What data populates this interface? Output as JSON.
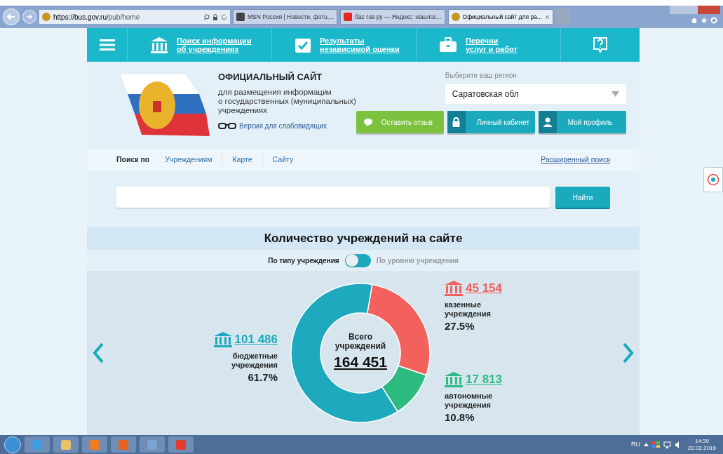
{
  "browser": {
    "address_host": "https://bus.gov.ru",
    "address_path": "/pub/home",
    "tabs": [
      {
        "title": "MSN Россия | Новости, фото,...",
        "kind": "msn",
        "selected": false
      },
      {
        "title": "бас гов ру — Яндекс: нашлос...",
        "kind": "yandex",
        "selected": false
      },
      {
        "title": "Официальный сайт для ра...",
        "kind": "site",
        "selected": true
      }
    ]
  },
  "nav": {
    "links": [
      {
        "kind": "building",
        "lines": [
          "Поиск информации",
          "об учреждениях"
        ]
      },
      {
        "kind": "check",
        "lines": [
          "Результаты",
          "независимой оценки"
        ]
      },
      {
        "kind": "case",
        "lines": [
          "Перечни",
          "услуг и работ"
        ]
      }
    ]
  },
  "header": {
    "title": "ОФИЦИАЛЬНЫЙ САЙТ",
    "description": [
      "для размещения информации",
      "о государственных (муниципальных)",
      "учреждениях"
    ],
    "low_vision_link": "Версия для слабовидящих",
    "region_label": "Выберите ваш регион",
    "region_value": "Саратовская обл",
    "buttons": [
      {
        "label": "Оставить отзыв",
        "kind": "feedback"
      },
      {
        "label": "Личный кабинет",
        "kind": "lock"
      },
      {
        "label": "Мой профиль",
        "kind": "user"
      }
    ]
  },
  "search": {
    "label": "Поиск по",
    "tabs": [
      {
        "label": "Учреждениям"
      },
      {
        "label": "Карте"
      },
      {
        "label": "Сайту"
      }
    ],
    "advanced_link": "Расширенный поиск",
    "button": "Найти"
  },
  "stats": {
    "title": "Количество учреждений на сайте",
    "toggle": {
      "left_label": "По типу учреждения",
      "right_label": "По уровню учреждения",
      "on": false
    },
    "total_label": [
      "Всего",
      "учреждений"
    ],
    "total": "164 451",
    "legend": [
      {
        "count": "101 486",
        "percent": "61.7%",
        "color": "#1fa9bf"
      },
      {
        "count": "45 154",
        "percent": "27.5%",
        "color": "#f2615d"
      },
      {
        "count": "17 813",
        "percent": "10.8%",
        "color": "#2dbb82"
      }
    ],
    "chart_data": {
      "type": "donut",
      "categories": [
        "бюджетные учреждения",
        "казенные учреждения",
        "автономные учреждения"
      ],
      "values": [
        61.7,
        27.5,
        10.8
      ]
    }
  },
  "taskbar": {
    "language": "RU",
    "time": "14:39",
    "date": "22.02.2019"
  }
}
